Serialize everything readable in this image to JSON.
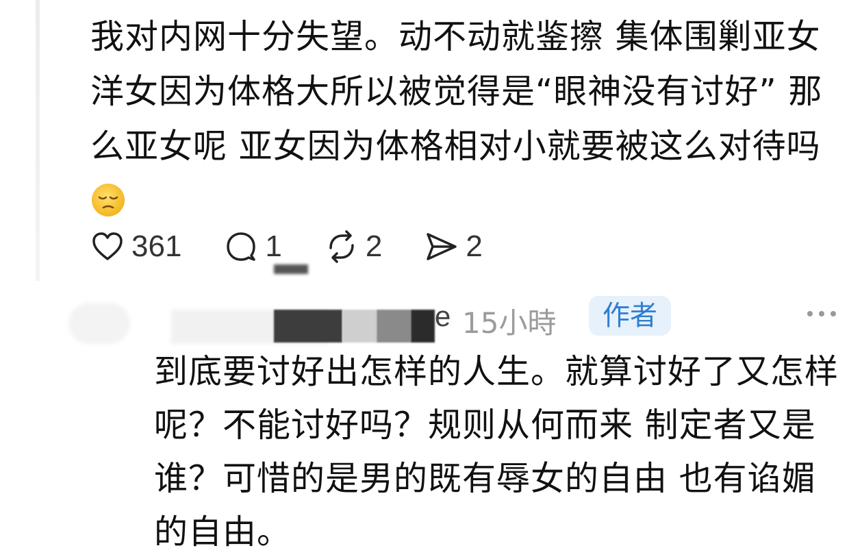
{
  "post": {
    "text": "我对内网十分失望。动不动就鉴擦 集体围剿亚女 洋女因为体格大所以被觉得是“眼神没有讨好” 那么亚女呢 亚女因为体格相对小就要被这么对待吗",
    "emoji": "pensive-face-emoji"
  },
  "actions": {
    "likes": "361",
    "comments": "1",
    "reposts": "2",
    "shares": "2"
  },
  "reply": {
    "username_visible": "e",
    "time": "15小時",
    "badge": "作者",
    "text": "到底要讨好出怎样的人生。就算讨好了又怎样呢？不能讨好吗？规则从何而来 制定者又是谁？可惜的是男的既有辱女的自由 也有谄媚的自由。"
  },
  "icons": {
    "like": "heart-icon",
    "comment": "comment-bubble-icon",
    "repost": "repost-icon",
    "share": "send-icon",
    "more": "more-dots-icon"
  },
  "colors": {
    "badge_bg": "#e6f1fb",
    "badge_text": "#2f7fd1",
    "muted": "#9b9b9b"
  }
}
